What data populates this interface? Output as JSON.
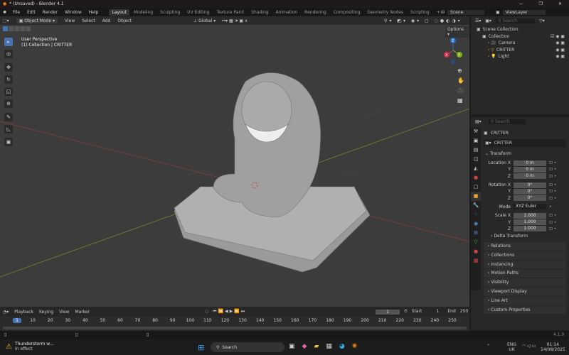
{
  "window": {
    "title": "* (Unsaved) - Blender 4.1"
  },
  "menu": [
    "File",
    "Edit",
    "Render",
    "Window",
    "Help"
  ],
  "workspaces": [
    "Layout",
    "Modeling",
    "Sculpting",
    "UV Editing",
    "Texture Paint",
    "Shading",
    "Animation",
    "Rendering",
    "Compositing",
    "Geometry Nodes",
    "Scripting",
    "+"
  ],
  "scene": "Scene",
  "view_layer": "ViewLayer",
  "viewport": {
    "mode": "Object Mode",
    "menus": [
      "View",
      "Select",
      "Add",
      "Object"
    ],
    "orientation": "Global",
    "options": "Options",
    "info_line1": "User Perspective",
    "info_line2": "(1) Collection | CRITTER",
    "gizmo": {
      "x": "X",
      "y": "Y",
      "z": "Z"
    }
  },
  "outliner": {
    "search_placeholder": "Search",
    "items": [
      {
        "label": "Scene Collection",
        "indent": 0
      },
      {
        "label": "Collection",
        "indent": 1
      },
      {
        "label": "Camera",
        "indent": 2
      },
      {
        "label": "CRITTER",
        "indent": 2
      },
      {
        "label": "Light",
        "indent": 2
      }
    ]
  },
  "properties": {
    "search_placeholder": "Search",
    "object_name": "CRITTER",
    "data_name": "CRITTER",
    "transform_label": "Transform",
    "fields": [
      {
        "label": "Location X",
        "value": "0 m"
      },
      {
        "label": "Y",
        "value": "0 m"
      },
      {
        "label": "Z",
        "value": "0 m"
      },
      {
        "label": "Rotation X",
        "value": "0°"
      },
      {
        "label": "Y",
        "value": "0°"
      },
      {
        "label": "Z",
        "value": "0°"
      },
      {
        "label": "Mode",
        "value": "XYZ Euler"
      },
      {
        "label": "Scale X",
        "value": "1.000"
      },
      {
        "label": "Y",
        "value": "1.000"
      },
      {
        "label": "Z",
        "value": "1.000"
      }
    ],
    "delta": "Delta Transform",
    "sections": [
      "Relations",
      "Collections",
      "Instancing",
      "Motion Paths",
      "Visibility",
      "Viewport Display",
      "Line Art",
      "Custom Properties"
    ]
  },
  "timeline": {
    "menus": [
      "Playback",
      "Keying",
      "View",
      "Marker"
    ],
    "current_frame": "1",
    "start_label": "Start",
    "start": "1",
    "end_label": "End",
    "end": "250",
    "ticks": [
      "1",
      "10",
      "20",
      "30",
      "40",
      "50",
      "60",
      "70",
      "80",
      "90",
      "100",
      "110",
      "120",
      "130",
      "140",
      "150",
      "160",
      "170",
      "180",
      "190",
      "200",
      "210",
      "220",
      "230",
      "240",
      "250"
    ]
  },
  "status": {
    "version": "4.1.0"
  },
  "taskbar": {
    "weather_title": "Thunderstorm w...",
    "weather_sub": "In effect",
    "search": "Search",
    "lang1": "ENG",
    "lang2": "UK",
    "time": "01:14",
    "date": "14/08/2025"
  }
}
